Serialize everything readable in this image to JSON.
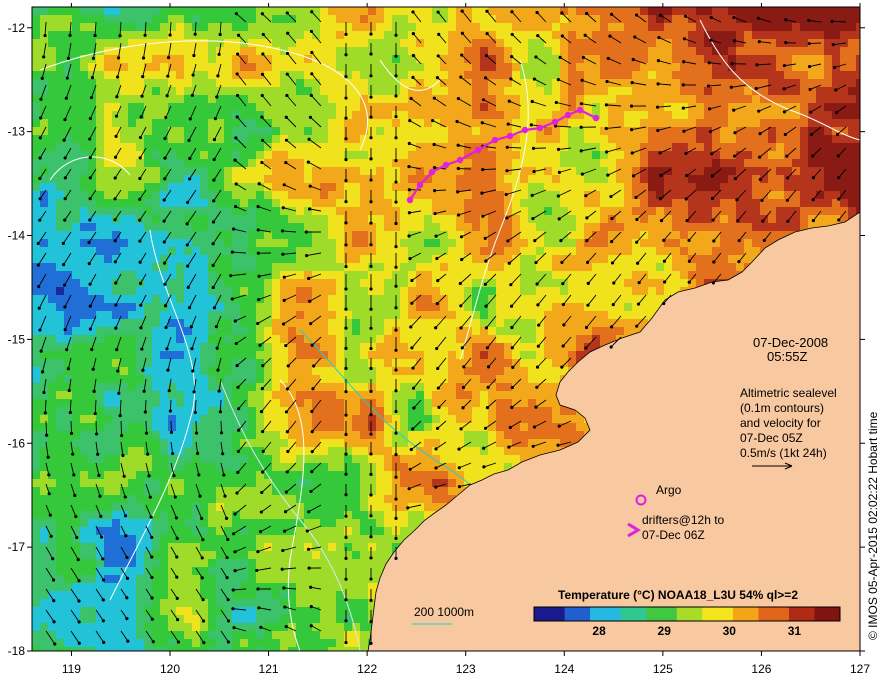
{
  "map": {
    "lon_range": [
      118.6,
      127
    ],
    "lat_range": [
      -18,
      -11.8
    ],
    "lon_ticks": [
      "119",
      "120",
      "121",
      "122",
      "123",
      "124",
      "125",
      "126",
      "127"
    ],
    "lat_ticks": [
      "-12",
      "-13",
      "-14",
      "-15",
      "-16",
      "-17",
      "-18"
    ],
    "land_color": "#f8c8a0",
    "ocean_palette": [
      "#1a2a9c",
      "#1f6fd6",
      "#22c2d8",
      "#3cc26a",
      "#35c83a",
      "#9fdc2a",
      "#f0e21c",
      "#f2a81a",
      "#e2701c",
      "#b5341c",
      "#8a1a14"
    ]
  },
  "annotations": {
    "date": "07-Dec-2008",
    "time": "05:55Z",
    "altimetry_line1": "Altimetric sealevel",
    "altimetry_line2": "(0.1m contours)",
    "altimetry_line3": "and velocity for",
    "altimetry_line4": "07-Dec 05Z",
    "velocity_scale": "0.5m/s (1kt 24h)",
    "argo_label": "Argo",
    "drifters_line1": "drifters@12h to",
    "drifters_line2": "07-Dec 06Z",
    "depth_contours": "200  1000m",
    "credit": "© IMOS 05-Apr-2015 02:02:22 Hobart time"
  },
  "colorbar": {
    "title": "Temperature (°C) NOAA18_L3U 54% ql>=2",
    "range": [
      27.0,
      31.7
    ],
    "ticks": [
      "28",
      "29",
      "30",
      "31"
    ],
    "colors": [
      "#1a1a8c",
      "#1f5fd0",
      "#25b8e0",
      "#30c890",
      "#40c840",
      "#a8dc28",
      "#f4e41c",
      "#f4a418",
      "#e0641a",
      "#b02a18",
      "#801410"
    ]
  }
}
